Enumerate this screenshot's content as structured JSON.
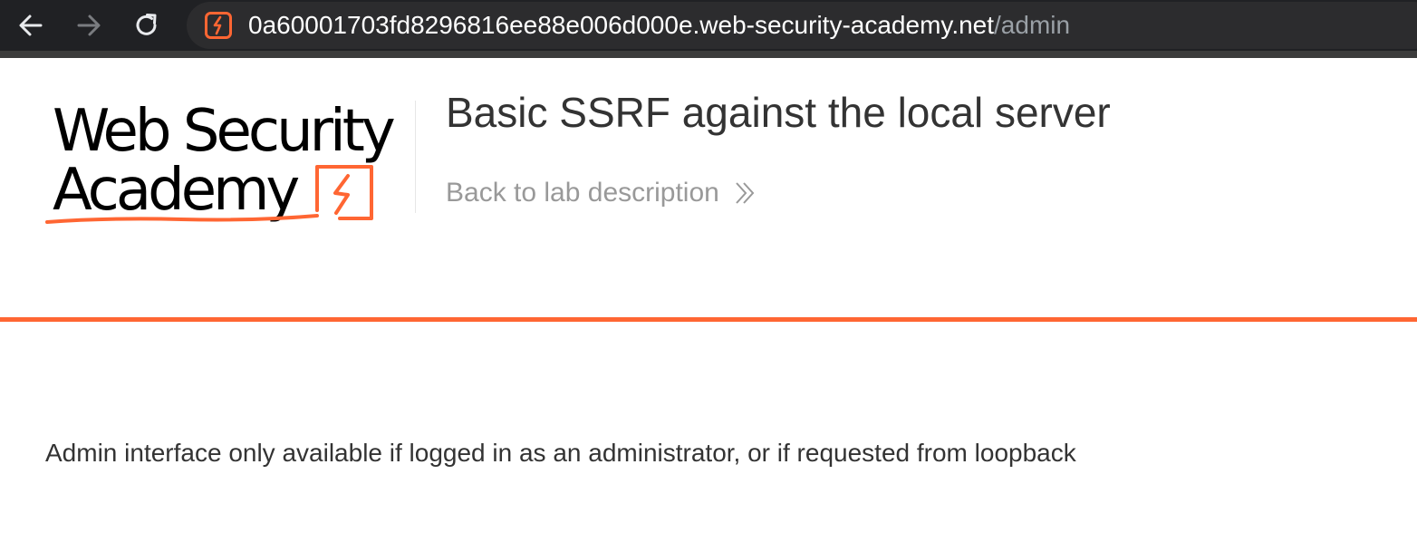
{
  "browser": {
    "url_host": "0a60001703fd8296816ee88e006d000e.web-security-academy.net",
    "url_path": "/admin",
    "site_icon": "lightning-icon",
    "nav": {
      "back_icon": "arrow-left-icon",
      "forward_icon": "arrow-right-icon",
      "reload_icon": "reload-icon"
    }
  },
  "header": {
    "logo_line1": "Web Security",
    "logo_line2": "Academy",
    "title": "Basic SSRF against the local server",
    "back_link_label": "Back to lab description",
    "back_link_icon": "double-chevron-right-icon"
  },
  "main": {
    "message": "Admin interface only available if logged in as an administrator, or if requested from loopback"
  },
  "colors": {
    "accent": "#ff6633",
    "toolbar_bg": "#202124",
    "text": "#333333",
    "muted": "#999999"
  }
}
